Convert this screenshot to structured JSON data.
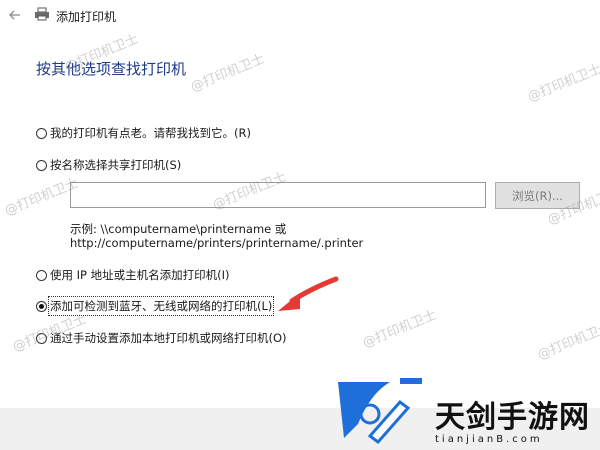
{
  "window": {
    "title": "添加打印机"
  },
  "heading": "按其他选项查找打印机",
  "options": [
    {
      "label": "我的打印机有点老。请帮我找到它。(R)",
      "checked": false
    },
    {
      "label": "按名称选择共享打印机(S)",
      "checked": false
    },
    {
      "label": "使用 IP 地址或主机名添加打印机(I)",
      "checked": false
    },
    {
      "label": "添加可检测到蓝牙、无线或网络的打印机(L)",
      "checked": true
    },
    {
      "label": "通过手动设置添加本地打印机或网络打印机(O)",
      "checked": false
    }
  ],
  "shared_printer": {
    "input_value": "",
    "browse_label": "浏览(R)...",
    "example_line1": "示例: \\\\computername\\printername 或",
    "example_line2": "http://computername/printers/printername/.printer"
  },
  "watermark": "@打印机卫士",
  "brand": {
    "name": "天剑手游网",
    "url_text": "tianjianB.com",
    "accent": "#1e6fd9"
  },
  "colors": {
    "heading": "#1e3a8a",
    "arrow": "#e53935",
    "footer": "#f0f0f0"
  }
}
